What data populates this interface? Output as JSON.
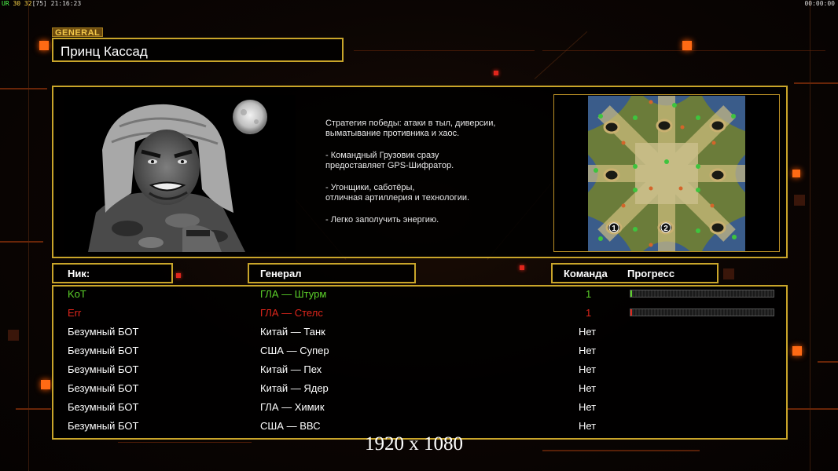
{
  "overlay": {
    "top_left_ur": "UR",
    "top_left_nums": "30 32",
    "top_left_bracket": "[75]",
    "top_left_clock": "21:16:23",
    "top_right_timer": "00:00:00"
  },
  "general": {
    "tag": "GENERAL",
    "name": "Принц Кассад"
  },
  "description": {
    "paragraphs": [
      "Стратегия победы: атаки в тыл, диверсии,\n выматывание противника и хаос.",
      "- Командный Грузовик сразу\nпредоставляет GPS-Шифратор.",
      "- Угонщики, саботёры,\nотличная артиллерия и технологии.",
      "- Легко заполучить энергию."
    ]
  },
  "map": {
    "start_positions": [
      "1",
      "2"
    ]
  },
  "columns": {
    "nick": "Ник:",
    "general": "Генерал",
    "team": "Команда",
    "progress": "Прогресс"
  },
  "players": [
    {
      "nick": "KoT",
      "general": "ГЛА — Штурм",
      "team": "1",
      "color": "#5cd12a",
      "progress": 0.01
    },
    {
      "nick": "Err",
      "general": "ГЛА — Стелс",
      "team": "1",
      "color": "#e0261c",
      "progress": 0.01
    },
    {
      "nick": "Безумный БОТ",
      "general": "Китай — Танк",
      "team": "Нет",
      "color": "#ffffff"
    },
    {
      "nick": "Безумный БОТ",
      "general": "США — Супер",
      "team": "Нет",
      "color": "#ffffff"
    },
    {
      "nick": "Безумный БОТ",
      "general": "Китай — Пех",
      "team": "Нет",
      "color": "#ffffff"
    },
    {
      "nick": "Безумный БОТ",
      "general": "Китай — Ядер",
      "team": "Нет",
      "color": "#ffffff"
    },
    {
      "nick": "Безумный БОТ",
      "general": "ГЛА — Химик",
      "team": "Нет",
      "color": "#ffffff"
    },
    {
      "nick": "Безумный БОТ",
      "general": "США — ВВС",
      "team": "Нет",
      "color": "#ffffff"
    }
  ],
  "resolution_caption": "1920 x 1080",
  "colors": {
    "accent_gold": "#c9a52a",
    "accent_orange": "#ff6a14"
  }
}
